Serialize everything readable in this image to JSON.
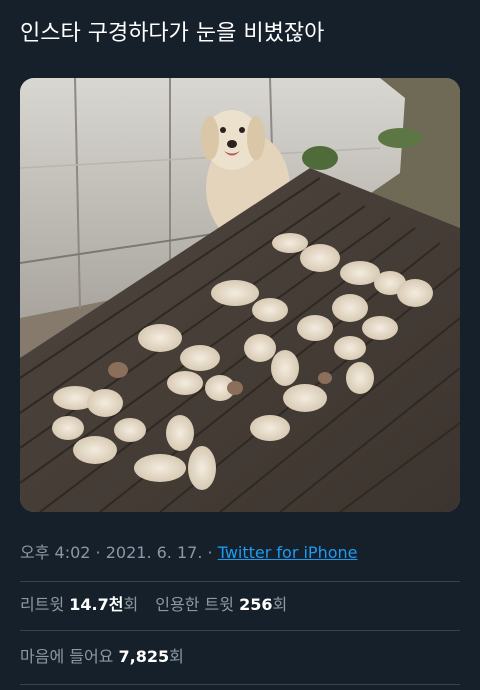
{
  "tweet": {
    "text": "인스타 구경하다가 눈을 비볐잖아"
  },
  "media": {
    "kind": "photo",
    "subject-icon": "golden-retriever-photo",
    "colors": {
      "deck": "#4a4039",
      "fur": "#e8dccb",
      "greenhouse": "#c9c6c0"
    }
  },
  "meta": {
    "time": "오후 4:02",
    "separator": " · ",
    "date": "2021. 6. 17.",
    "source": "Twitter for iPhone"
  },
  "stats": {
    "retweets_label": "리트윗",
    "retweets_value": "14.7천",
    "retweets_unit": "회",
    "quotes_label": "인용한 트윗",
    "quotes_value": "256",
    "quotes_unit": "회",
    "likes_label": "마음에 들어요",
    "likes_value": "7,825",
    "likes_unit": "회"
  },
  "colors": {
    "background": "#15202b",
    "text": "#ffffff",
    "muted": "#8b98a5",
    "link": "#1d9bf0",
    "divider": "#38444d"
  }
}
